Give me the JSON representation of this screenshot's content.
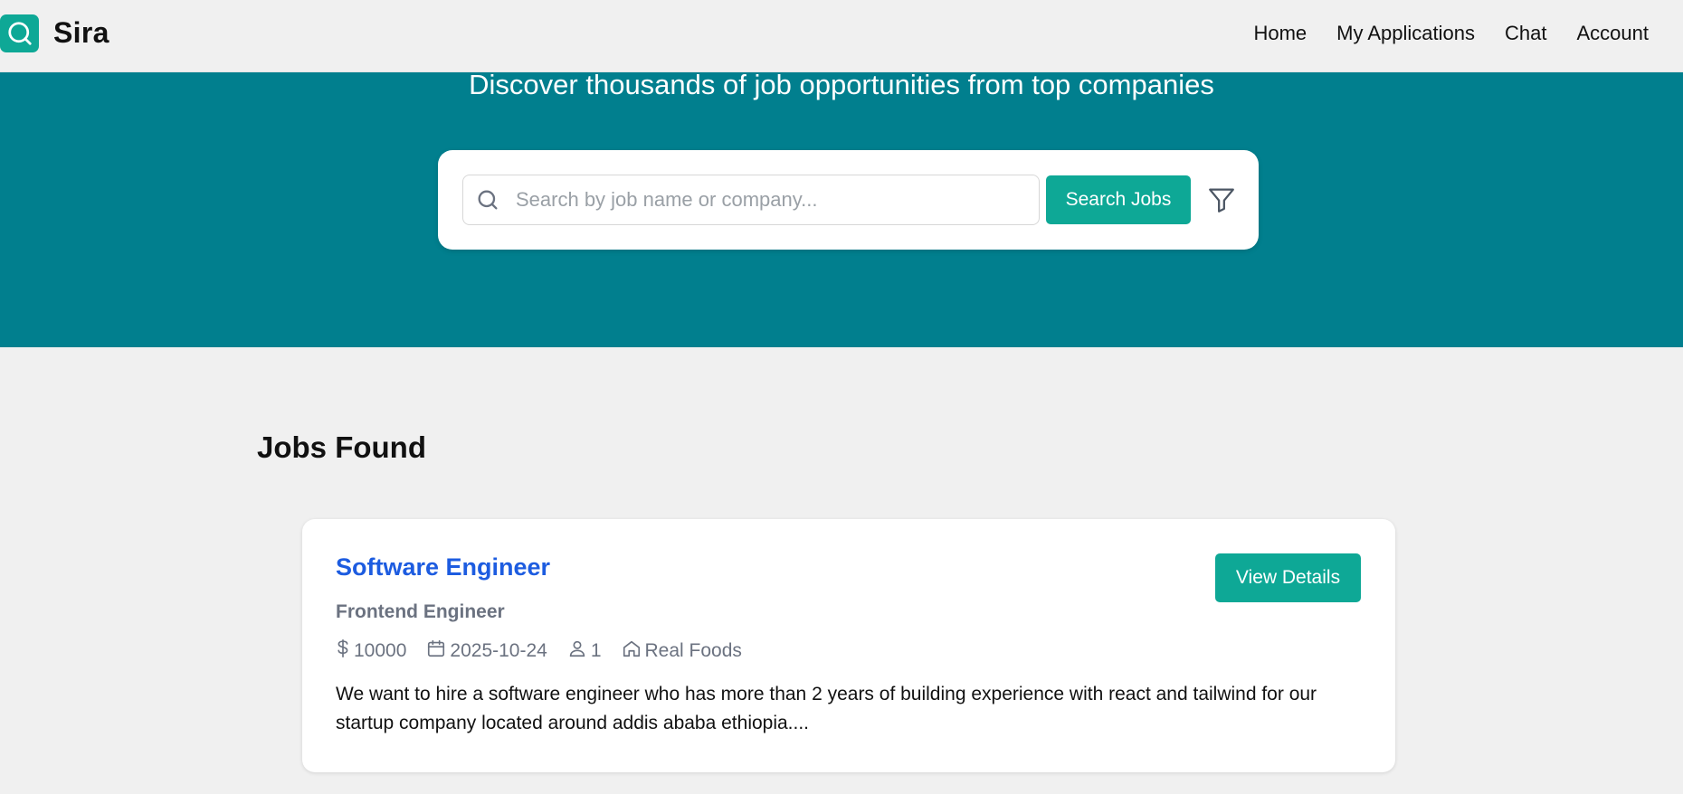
{
  "header": {
    "brand": "Sira",
    "nav": [
      "Home",
      "My Applications",
      "Chat",
      "Account"
    ]
  },
  "hero": {
    "subtitle": "Discover thousands of job opportunities from top companies",
    "search_placeholder": "Search by job name or company...",
    "search_value": "",
    "search_button": "Search Jobs",
    "filter_icon": "filter-icon"
  },
  "results": {
    "title": "Jobs Found",
    "jobs": [
      {
        "title": "Software Engineer",
        "subtitle": "Frontend Engineer",
        "salary": "10000",
        "date": "2025-10-24",
        "positions": "1",
        "company": "Real Foods",
        "description": "We want to hire a software engineer who has more than 2 years of building experience with react and tailwind for our startup company located around addis ababa ethiopia....",
        "button": "View Details"
      }
    ]
  },
  "colors": {
    "accent": "#0ea896",
    "hero_bg": "#017f8e",
    "job_title": "#1d5ce0",
    "page_bg": "#f0f0f0"
  }
}
